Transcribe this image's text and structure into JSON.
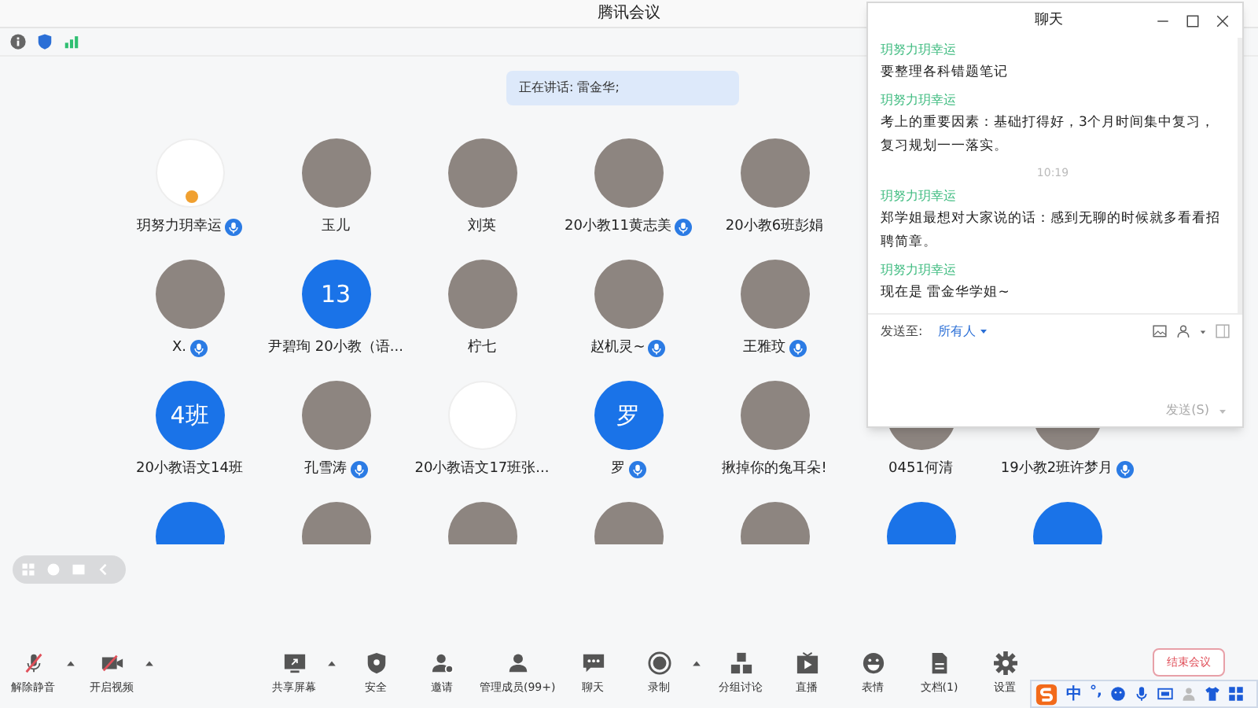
{
  "window": {
    "title": "腾讯会议"
  },
  "speaking_banner": "正在讲话: 雷金华;",
  "participant_rows": [
    [
      {
        "name": "玥努力玥幸运",
        "kind": "emblem",
        "host": true,
        "mic": true
      },
      {
        "name": "玉儿",
        "kind": "photo",
        "host": false,
        "mic": false
      },
      {
        "name": "刘英",
        "kind": "photo",
        "host": false,
        "mic": false
      },
      {
        "name": "20小教11黄志美",
        "kind": "photo",
        "host": false,
        "mic": true
      },
      {
        "name": "20小教6班彭娟",
        "kind": "photo",
        "host": false,
        "mic": false
      }
    ],
    [
      {
        "name": "X.",
        "kind": "photo",
        "host": false,
        "mic": true
      },
      {
        "name": "尹碧珣 20小教（语...",
        "kind": "initials",
        "initials": "13",
        "host": false,
        "mic": false
      },
      {
        "name": "柠七",
        "kind": "photo",
        "host": false,
        "mic": false
      },
      {
        "name": "赵机灵~",
        "kind": "photo",
        "host": false,
        "mic": true
      },
      {
        "name": "王雅玟",
        "kind": "photo",
        "host": false,
        "mic": true
      }
    ],
    [
      {
        "name": "20小教语文14班",
        "kind": "initials",
        "initials": "4班",
        "host": false,
        "mic": false
      },
      {
        "name": "孔雪涛",
        "kind": "photo",
        "host": false,
        "mic": true
      },
      {
        "name": "20小教语文17班张...",
        "kind": "emblem",
        "host": false,
        "mic": false
      },
      {
        "name": "罗",
        "kind": "initials",
        "initials": "罗",
        "host": false,
        "mic": true
      },
      {
        "name": "揪掉你的兔耳朵!",
        "kind": "photo",
        "host": false,
        "mic": false
      },
      {
        "name": "0451何清",
        "kind": "photo",
        "host": false,
        "mic": false
      },
      {
        "name": "19小教2班许梦月",
        "kind": "photo",
        "host": false,
        "mic": true
      }
    ],
    [
      {
        "kind": "initials"
      },
      {
        "kind": "photo"
      },
      {
        "kind": "photo"
      },
      {
        "kind": "photo"
      },
      {
        "kind": "photo"
      },
      {
        "kind": "initials"
      },
      {
        "kind": "initials"
      }
    ]
  ],
  "chat": {
    "title": "聊天",
    "messages": [
      {
        "kind": "sender",
        "text": "玥努力玥幸运"
      },
      {
        "kind": "text",
        "text": "要整理各科错题笔记"
      },
      {
        "kind": "sender",
        "text": "玥努力玥幸运"
      },
      {
        "kind": "text",
        "text": "考上的重要因素：基础打得好，3个月时间集中复习，复习规划一一落实。"
      },
      {
        "kind": "time",
        "text": "10:19"
      },
      {
        "kind": "sender",
        "text": "玥努力玥幸运"
      },
      {
        "kind": "text",
        "text": "郑学姐最想对大家说的话：感到无聊的时候就多看看招聘简章。"
      },
      {
        "kind": "sender",
        "text": "玥努力玥幸运"
      },
      {
        "kind": "text",
        "text": "现在是 雷金华学姐~"
      }
    ],
    "send_to_label": "发送至:",
    "recipient": "所有人",
    "send_button": "发送(S)"
  },
  "toolbar": [
    {
      "kind": "mic",
      "label": "解除静音",
      "caret": true
    },
    {
      "kind": "video",
      "label": "开启视频",
      "caret": true
    },
    {
      "kind": "share",
      "label": "共享屏幕",
      "caret": true
    },
    {
      "kind": "shield",
      "label": "安全",
      "caret": false
    },
    {
      "kind": "invite",
      "label": "邀请",
      "caret": false
    },
    {
      "kind": "members",
      "label": "管理成员(99+)",
      "caret": false
    },
    {
      "kind": "chat",
      "label": "聊天",
      "caret": false
    },
    {
      "kind": "record",
      "label": "录制",
      "caret": true
    },
    {
      "kind": "breakout",
      "label": "分组讨论",
      "caret": false
    },
    {
      "kind": "live",
      "label": "直播",
      "caret": false
    },
    {
      "kind": "emoji",
      "label": "表情",
      "caret": false
    },
    {
      "kind": "doc",
      "label": "文档(1)",
      "caret": false
    },
    {
      "kind": "settings",
      "label": "设置",
      "caret": false
    }
  ],
  "end_button": "结束会议",
  "ime_bar": {
    "mode": "中",
    "punctuation": "°,"
  }
}
